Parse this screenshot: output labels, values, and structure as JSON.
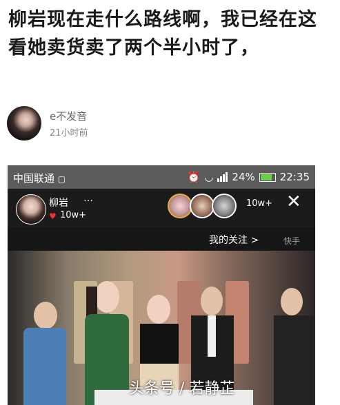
{
  "post": {
    "text": "柳岩现在走什么路线啊，我已经在这看她卖货卖了两个半小时了，"
  },
  "author": {
    "name": "e不发音",
    "time": "21小时前"
  },
  "screenshot": {
    "status_bar": {
      "carrier": "中国联通",
      "battery": "24%",
      "time": "22:35"
    },
    "live": {
      "host_name": "柳岩",
      "host_more": "…",
      "host_likes": "10w+",
      "viewer_count": "10w+",
      "follow_label": "我的关注",
      "follow_chevron": ">",
      "app_tag": "快手"
    },
    "watermark": "头条号 / 若静芷"
  },
  "colors": {
    "status_bar_bg": "#5b5b5b",
    "battery_fill": "#6ad04a",
    "heart": "#e33333"
  }
}
